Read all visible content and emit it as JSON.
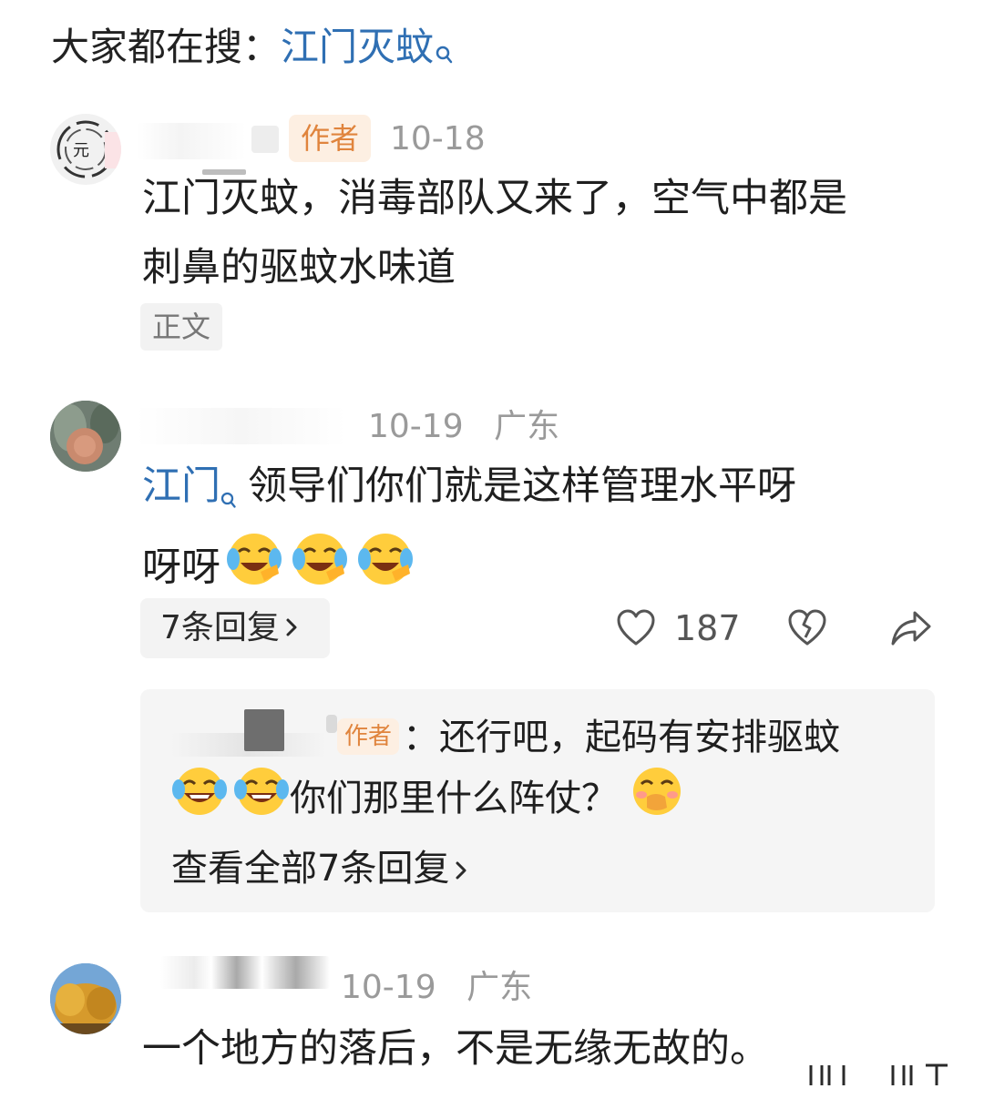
{
  "search": {
    "prefix": "大家都在搜：",
    "term": "江门灭蚊"
  },
  "comments": [
    {
      "badge": "作者",
      "date": "10-18",
      "text_line1": "江门灭蚊，消毒部队又来了，空气中都是",
      "text_line2": "刺鼻的驱蚊水味道",
      "tag": "正文"
    },
    {
      "date": "10-19",
      "location": "广东",
      "keyword": "江门",
      "text_line1_rest": "领导们你们就是这样管理水平呀",
      "text_line2": "呀呀",
      "reply_count_label": "7条回复",
      "like_count": "187",
      "reply_preview": {
        "badge": "作者",
        "line1": "：还行吧，起码有安排驱蚊",
        "line2": "你们那里什么阵仗？",
        "view_all": "查看全部7条回复"
      }
    },
    {
      "date": "10-19",
      "location": "广东",
      "text_line1": "一个地方的落后，不是无缘无故的。"
    }
  ],
  "colors": {
    "link": "#2f6fb3",
    "author_badge_bg": "#fdefe2",
    "author_badge_text": "#e0843d"
  },
  "icons": [
    "search-icon",
    "heart-icon",
    "dislike-icon",
    "share-icon",
    "chevron-right-icon"
  ]
}
